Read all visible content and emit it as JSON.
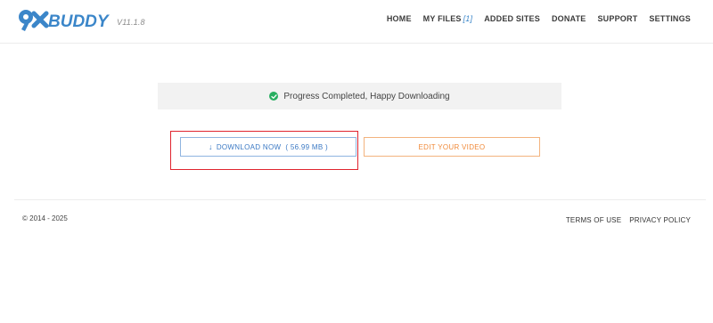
{
  "brand": {
    "logo_prefix": "9X",
    "logo_name": "BUDDY",
    "version": "V11.1.8",
    "color": "#3b86c9"
  },
  "nav": {
    "items": [
      {
        "label": "HOME"
      },
      {
        "label": "MY FILES",
        "count": "[1]"
      },
      {
        "label": "ADDED SITES"
      },
      {
        "label": "DONATE"
      },
      {
        "label": "SUPPORT"
      },
      {
        "label": "SETTINGS"
      }
    ]
  },
  "status": {
    "icon": "check-circle-icon",
    "text": "Progress Completed, Happy Downloading",
    "color": "#27ae60"
  },
  "actions": {
    "download_icon": "arrow-down-icon",
    "download_label": "DOWNLOAD NOW  ( 56.99 MB )",
    "edit_label": "EDIT YOUR VIDEO",
    "highlight_color": "#e0242e"
  },
  "footer": {
    "copyright": "© 2014 - 2025",
    "links": [
      "TERMS OF USE",
      "PRIVACY POLICY"
    ]
  }
}
